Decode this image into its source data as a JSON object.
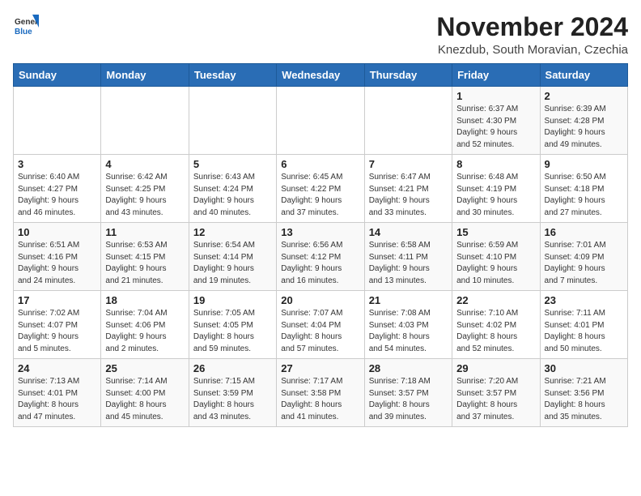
{
  "logo": {
    "general": "General",
    "blue": "Blue"
  },
  "title": "November 2024",
  "subtitle": "Knezdub, South Moravian, Czechia",
  "days_of_week": [
    "Sunday",
    "Monday",
    "Tuesday",
    "Wednesday",
    "Thursday",
    "Friday",
    "Saturday"
  ],
  "weeks": [
    [
      {
        "day": "",
        "info": ""
      },
      {
        "day": "",
        "info": ""
      },
      {
        "day": "",
        "info": ""
      },
      {
        "day": "",
        "info": ""
      },
      {
        "day": "",
        "info": ""
      },
      {
        "day": "1",
        "info": "Sunrise: 6:37 AM\nSunset: 4:30 PM\nDaylight: 9 hours\nand 52 minutes."
      },
      {
        "day": "2",
        "info": "Sunrise: 6:39 AM\nSunset: 4:28 PM\nDaylight: 9 hours\nand 49 minutes."
      }
    ],
    [
      {
        "day": "3",
        "info": "Sunrise: 6:40 AM\nSunset: 4:27 PM\nDaylight: 9 hours\nand 46 minutes."
      },
      {
        "day": "4",
        "info": "Sunrise: 6:42 AM\nSunset: 4:25 PM\nDaylight: 9 hours\nand 43 minutes."
      },
      {
        "day": "5",
        "info": "Sunrise: 6:43 AM\nSunset: 4:24 PM\nDaylight: 9 hours\nand 40 minutes."
      },
      {
        "day": "6",
        "info": "Sunrise: 6:45 AM\nSunset: 4:22 PM\nDaylight: 9 hours\nand 37 minutes."
      },
      {
        "day": "7",
        "info": "Sunrise: 6:47 AM\nSunset: 4:21 PM\nDaylight: 9 hours\nand 33 minutes."
      },
      {
        "day": "8",
        "info": "Sunrise: 6:48 AM\nSunset: 4:19 PM\nDaylight: 9 hours\nand 30 minutes."
      },
      {
        "day": "9",
        "info": "Sunrise: 6:50 AM\nSunset: 4:18 PM\nDaylight: 9 hours\nand 27 minutes."
      }
    ],
    [
      {
        "day": "10",
        "info": "Sunrise: 6:51 AM\nSunset: 4:16 PM\nDaylight: 9 hours\nand 24 minutes."
      },
      {
        "day": "11",
        "info": "Sunrise: 6:53 AM\nSunset: 4:15 PM\nDaylight: 9 hours\nand 21 minutes."
      },
      {
        "day": "12",
        "info": "Sunrise: 6:54 AM\nSunset: 4:14 PM\nDaylight: 9 hours\nand 19 minutes."
      },
      {
        "day": "13",
        "info": "Sunrise: 6:56 AM\nSunset: 4:12 PM\nDaylight: 9 hours\nand 16 minutes."
      },
      {
        "day": "14",
        "info": "Sunrise: 6:58 AM\nSunset: 4:11 PM\nDaylight: 9 hours\nand 13 minutes."
      },
      {
        "day": "15",
        "info": "Sunrise: 6:59 AM\nSunset: 4:10 PM\nDaylight: 9 hours\nand 10 minutes."
      },
      {
        "day": "16",
        "info": "Sunrise: 7:01 AM\nSunset: 4:09 PM\nDaylight: 9 hours\nand 7 minutes."
      }
    ],
    [
      {
        "day": "17",
        "info": "Sunrise: 7:02 AM\nSunset: 4:07 PM\nDaylight: 9 hours\nand 5 minutes."
      },
      {
        "day": "18",
        "info": "Sunrise: 7:04 AM\nSunset: 4:06 PM\nDaylight: 9 hours\nand 2 minutes."
      },
      {
        "day": "19",
        "info": "Sunrise: 7:05 AM\nSunset: 4:05 PM\nDaylight: 8 hours\nand 59 minutes."
      },
      {
        "day": "20",
        "info": "Sunrise: 7:07 AM\nSunset: 4:04 PM\nDaylight: 8 hours\nand 57 minutes."
      },
      {
        "day": "21",
        "info": "Sunrise: 7:08 AM\nSunset: 4:03 PM\nDaylight: 8 hours\nand 54 minutes."
      },
      {
        "day": "22",
        "info": "Sunrise: 7:10 AM\nSunset: 4:02 PM\nDaylight: 8 hours\nand 52 minutes."
      },
      {
        "day": "23",
        "info": "Sunrise: 7:11 AM\nSunset: 4:01 PM\nDaylight: 8 hours\nand 50 minutes."
      }
    ],
    [
      {
        "day": "24",
        "info": "Sunrise: 7:13 AM\nSunset: 4:01 PM\nDaylight: 8 hours\nand 47 minutes."
      },
      {
        "day": "25",
        "info": "Sunrise: 7:14 AM\nSunset: 4:00 PM\nDaylight: 8 hours\nand 45 minutes."
      },
      {
        "day": "26",
        "info": "Sunrise: 7:15 AM\nSunset: 3:59 PM\nDaylight: 8 hours\nand 43 minutes."
      },
      {
        "day": "27",
        "info": "Sunrise: 7:17 AM\nSunset: 3:58 PM\nDaylight: 8 hours\nand 41 minutes."
      },
      {
        "day": "28",
        "info": "Sunrise: 7:18 AM\nSunset: 3:57 PM\nDaylight: 8 hours\nand 39 minutes."
      },
      {
        "day": "29",
        "info": "Sunrise: 7:20 AM\nSunset: 3:57 PM\nDaylight: 8 hours\nand 37 minutes."
      },
      {
        "day": "30",
        "info": "Sunrise: 7:21 AM\nSunset: 3:56 PM\nDaylight: 8 hours\nand 35 minutes."
      }
    ]
  ]
}
